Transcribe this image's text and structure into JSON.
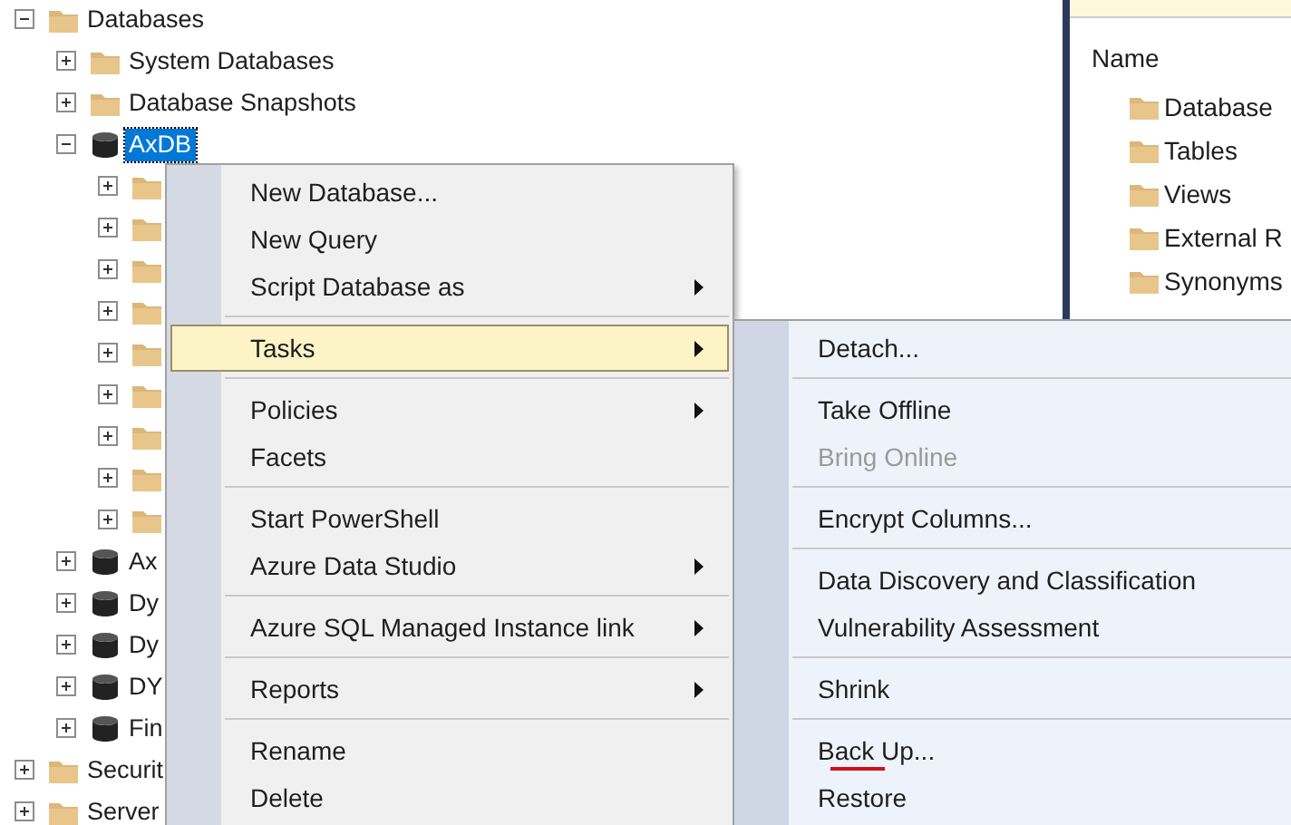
{
  "tree": [
    {
      "label": "Databases",
      "kind": "folder",
      "expanded": true,
      "selected": false,
      "children": [
        {
          "label": "System Databases",
          "kind": "folder",
          "expanded": false,
          "selected": false
        },
        {
          "label": "Database Snapshots",
          "kind": "folder",
          "expanded": false,
          "selected": false
        },
        {
          "label": "AxDB",
          "kind": "database",
          "expanded": true,
          "selected": true,
          "children": [
            {
              "kind": "folder",
              "expanded": false
            },
            {
              "kind": "folder",
              "expanded": false
            },
            {
              "kind": "folder",
              "expanded": false
            },
            {
              "kind": "folder",
              "expanded": false
            },
            {
              "kind": "folder",
              "expanded": false
            },
            {
              "kind": "folder",
              "expanded": false
            },
            {
              "kind": "folder",
              "expanded": false
            },
            {
              "kind": "folder",
              "expanded": false
            },
            {
              "kind": "folder",
              "expanded": false
            }
          ]
        },
        {
          "label": "Ax",
          "kind": "database",
          "expanded": false,
          "selected": false
        },
        {
          "label": "Dy",
          "kind": "database",
          "expanded": false,
          "selected": false
        },
        {
          "label": "Dy",
          "kind": "database",
          "expanded": false,
          "selected": false
        },
        {
          "label": "DY",
          "kind": "database",
          "expanded": false,
          "selected": false
        },
        {
          "label": "Fin",
          "kind": "database",
          "expanded": false,
          "selected": false
        }
      ]
    },
    {
      "label": "Securit",
      "kind": "folder",
      "expanded": false,
      "selected": false
    },
    {
      "label": "Server",
      "kind": "folder",
      "expanded": false,
      "selected": false
    }
  ],
  "details": {
    "header": "Name",
    "items": [
      {
        "label": "Database"
      },
      {
        "label": "Tables"
      },
      {
        "label": "Views"
      },
      {
        "label": "External R"
      },
      {
        "label": "Synonyms"
      }
    ]
  },
  "context_menu": [
    {
      "kind": "item",
      "label": "New Database...",
      "submenu": false,
      "selected": false
    },
    {
      "kind": "item",
      "label": "New Query",
      "submenu": false,
      "selected": false
    },
    {
      "kind": "item",
      "label": "Script Database as",
      "submenu": true,
      "selected": false
    },
    {
      "kind": "separator"
    },
    {
      "kind": "item",
      "label": "Tasks",
      "submenu": true,
      "selected": true
    },
    {
      "kind": "separator"
    },
    {
      "kind": "item",
      "label": "Policies",
      "submenu": true,
      "selected": false
    },
    {
      "kind": "item",
      "label": "Facets",
      "submenu": false,
      "selected": false
    },
    {
      "kind": "separator"
    },
    {
      "kind": "item",
      "label": "Start PowerShell",
      "submenu": false,
      "selected": false
    },
    {
      "kind": "item",
      "label": "Azure Data Studio",
      "submenu": true,
      "selected": false
    },
    {
      "kind": "separator"
    },
    {
      "kind": "item",
      "label": "Azure SQL Managed Instance link",
      "submenu": true,
      "selected": false
    },
    {
      "kind": "separator"
    },
    {
      "kind": "item",
      "label": "Reports",
      "submenu": true,
      "selected": false
    },
    {
      "kind": "separator"
    },
    {
      "kind": "item",
      "label": "Rename",
      "submenu": false,
      "selected": false
    },
    {
      "kind": "item",
      "label": "Delete",
      "submenu": false,
      "selected": false
    }
  ],
  "tasks_submenu": [
    {
      "kind": "item",
      "label": "Detach...",
      "disabled": false,
      "underlined": false
    },
    {
      "kind": "separator"
    },
    {
      "kind": "item",
      "label": "Take Offline",
      "disabled": false,
      "underlined": false
    },
    {
      "kind": "item",
      "label": "Bring Online",
      "disabled": true,
      "underlined": false
    },
    {
      "kind": "separator"
    },
    {
      "kind": "item",
      "label": "Encrypt Columns...",
      "disabled": false,
      "underlined": false
    },
    {
      "kind": "separator"
    },
    {
      "kind": "item",
      "label": "Data Discovery and Classification",
      "disabled": false,
      "underlined": false
    },
    {
      "kind": "item",
      "label": "Vulnerability Assessment",
      "disabled": false,
      "underlined": false
    },
    {
      "kind": "separator"
    },
    {
      "kind": "item",
      "label": "Shrink",
      "disabled": false,
      "underlined": false
    },
    {
      "kind": "separator"
    },
    {
      "kind": "item",
      "label": "Back Up...",
      "disabled": false,
      "underlined": true
    },
    {
      "kind": "item",
      "label": "Restore",
      "disabled": false,
      "underlined": false
    }
  ]
}
